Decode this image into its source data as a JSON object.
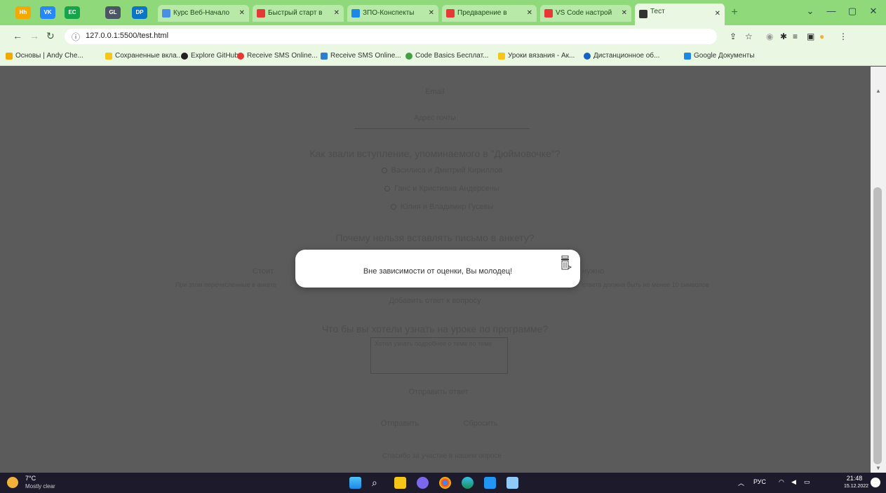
{
  "colors": {
    "accent": "#8fd97a",
    "tab_bg": "#b8e9a8",
    "page_overlay": "#5b5b5b",
    "modal_bg": "#ffffff"
  },
  "browser": {
    "pinned_tabs": [
      {
        "label": "Hh",
        "color": "#f2a900",
        "icon": "hh-icon"
      },
      {
        "label": "VK",
        "color": "#2787f5",
        "icon": "vk-icon"
      },
      {
        "label": "EC",
        "color": "#16a34a",
        "icon": "green-app-icon"
      },
      {
        "label": "GL",
        "color": "#4b5563",
        "icon": "gray-app-icon"
      },
      {
        "label": "DP",
        "color": "#0b76c5",
        "icon": "blue-app-icon"
      }
    ],
    "tabs": [
      {
        "title": "Курс Веб-Начало",
        "icon_color": "#4a90e2"
      },
      {
        "title": "Быстрый старт в",
        "icon_color": "#e53935"
      },
      {
        "title": "ЗПО-Конспекты",
        "icon_color": "#1e88e5"
      },
      {
        "title": "Предварение в",
        "icon_color": "#e53935"
      },
      {
        "title": "VS Code настрой",
        "icon_color": "#e53935"
      },
      {
        "title": "Тест",
        "icon_color": "#333333"
      }
    ],
    "url": "127.0.0.1:5500/test.html",
    "bookmarks": [
      {
        "label": "Основы | Andy Che...",
        "color": "#f2a900"
      },
      {
        "label": "Сохраненные вкла...",
        "color": "#f5c518"
      },
      {
        "label": "Explore GitHub",
        "color": "#222222"
      },
      {
        "label": "Receive SMS Online...",
        "color": "#e53935"
      },
      {
        "label": "Receive SMS Online...",
        "color": "#2e7dd1"
      },
      {
        "label": "Code Basics Бесплат...",
        "color": "#43a047"
      },
      {
        "label": "Уроки вязания - Ак...",
        "color": "#f5c518"
      },
      {
        "label": "Дистанционное об...",
        "color": "#1565c0"
      },
      {
        "label": "Google Документы",
        "color": "#1e88e5"
      }
    ]
  },
  "page": {
    "line1": "Email",
    "line2": "Адрес почты",
    "q1": "Как звали вступление, упоминаемого в \"Дюймовочке\"?",
    "q1_options": [
      "Василиса и Дмитрий Кириллов",
      "Ганс и Кристиана Андерсены",
      "Юлия и Владимир Гусевы"
    ],
    "q2": "Почему нельзя вставлять письмо в анкету?",
    "q2_fragment_left": "Стоит",
    "q2_fragment_right": "нужно",
    "q2_sub_left": "При этом перечисленные в анкете",
    "q2_sub_right": "ответа должна быть не менее 10 символов",
    "q2_button": "Добавить ответ к вопросу",
    "q3": "Что бы вы хотели узнать на уроке по программе?",
    "textarea_placeholder": "Хотел узнать подробнее о теме по теме",
    "submit_label": "Отправить ответ",
    "btn_left": "Отправить",
    "btn_right": "Сбросить",
    "footer": "Спасибо за участие в нашем опросе"
  },
  "modal": {
    "message": "Вне зависимости от оценки, Вы молодец!"
  },
  "taskbar": {
    "temp": "7°C",
    "weather": "Mostly clear",
    "lang": "РУС",
    "time": "21:48",
    "date": "15.12.2022"
  }
}
